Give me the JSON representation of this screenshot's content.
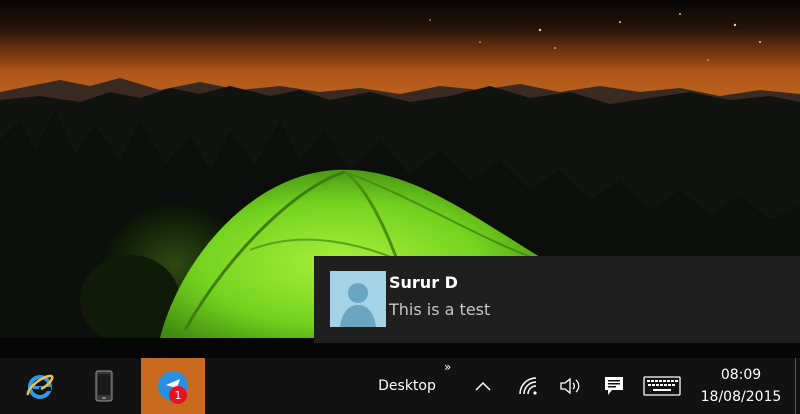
{
  "notification": {
    "sender": "Surur D",
    "message": "This is a test"
  },
  "taskbar": {
    "apps": [
      {
        "name": "internet-explorer",
        "icon": "internet-explorer-icon"
      },
      {
        "name": "phone",
        "icon": "phone-icon"
      },
      {
        "name": "messaging",
        "icon": "messaging-icon",
        "active": true,
        "badge": "1"
      }
    ],
    "toolbar_label": "Desktop",
    "toolbar_chevron": "»",
    "clock": {
      "time": "08:09",
      "date": "18/08/2015"
    }
  },
  "colors": {
    "taskbar": "#121212",
    "active_app": "#ca6a1f",
    "badge": "#e81123",
    "toast_bg": "#1f1f1f",
    "tent": "#7bd62a"
  }
}
